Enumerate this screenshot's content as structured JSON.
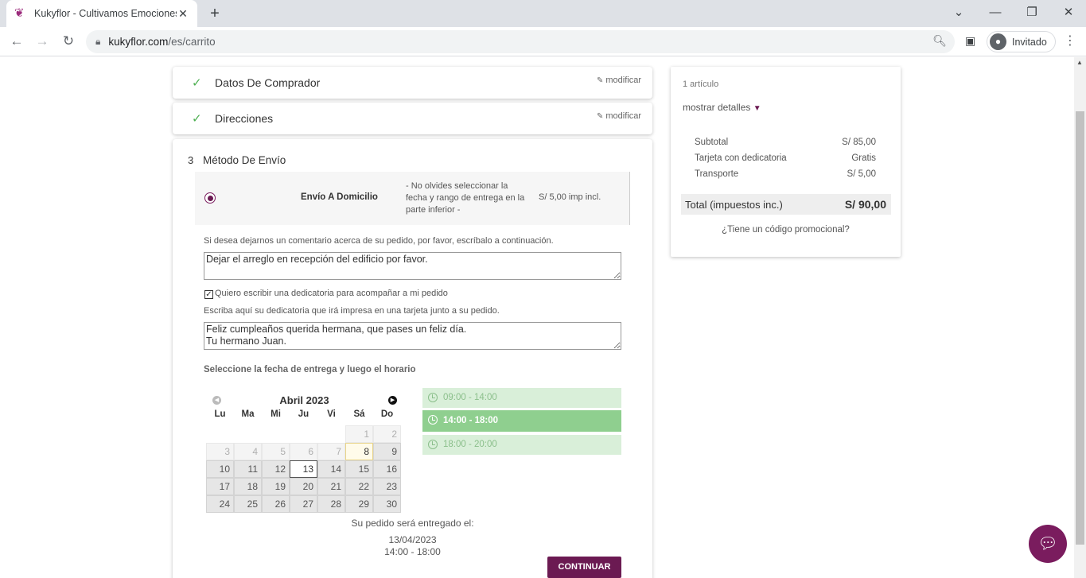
{
  "browser": {
    "tab_title": "Kukyflor - Cultivamos Emociones",
    "url_host": "kukyflor.com",
    "url_path": "/es/carrito",
    "profile_label": "Invitado",
    "new_tab": "+",
    "tab_close": "✕",
    "minimize": "—",
    "chevron": "⌄",
    "restore": "❐",
    "close": "✕",
    "back": "←",
    "forward": "→",
    "reload": "↻"
  },
  "checkout": {
    "step1": {
      "title": "Datos De Comprador",
      "modify": "modificar",
      "check": "✓"
    },
    "step2": {
      "title": "Direcciones",
      "modify": "modificar",
      "check": "✓"
    },
    "step3": {
      "number": "3",
      "title": "Método De Envío",
      "carrier": {
        "name": "Envío A Domicilio",
        "note": "- No olvides seleccionar la fecha y rango de entrega en la parte inferior -",
        "price": "S/ 5,00 imp incl."
      },
      "comment_label": "Si desea dejarnos un comentario acerca de su pedido, por favor, escríbalo a continuación.",
      "comment_value": "Dejar el arreglo en recepción del edificio por favor.",
      "dedication_checkbox_label": "Quiero escribir una dedicatoria para acompañar a mi pedido",
      "dedication_checked": "✓",
      "dedication_label": "Escriba aquí su dedicatoria que irá impresa en una tarjeta junto a su pedido.",
      "dedication_value": "Feliz cumpleaños querida hermana, que pases un feliz día.\nTu hermano Juan.",
      "date_prompt": "Seleccione la fecha de entrega y luego el horario",
      "calendar": {
        "month": "Abril 2023",
        "prev": "◀",
        "next": "▶",
        "weekdays": [
          "Lu",
          "Ma",
          "Mi",
          "Ju",
          "Vi",
          "Sá",
          "Do"
        ],
        "days": [
          {
            "d": "",
            "s": "blank"
          },
          {
            "d": "",
            "s": "blank"
          },
          {
            "d": "",
            "s": "blank"
          },
          {
            "d": "",
            "s": "blank"
          },
          {
            "d": "",
            "s": "blank"
          },
          {
            "d": "1",
            "s": "dis"
          },
          {
            "d": "2",
            "s": "dis"
          },
          {
            "d": "3",
            "s": "dis"
          },
          {
            "d": "4",
            "s": "dis"
          },
          {
            "d": "5",
            "s": "dis"
          },
          {
            "d": "6",
            "s": "dis"
          },
          {
            "d": "7",
            "s": "dis"
          },
          {
            "d": "8",
            "s": "hl"
          },
          {
            "d": "9",
            "s": ""
          },
          {
            "d": "10",
            "s": ""
          },
          {
            "d": "11",
            "s": ""
          },
          {
            "d": "12",
            "s": ""
          },
          {
            "d": "13",
            "s": "sel"
          },
          {
            "d": "14",
            "s": ""
          },
          {
            "d": "15",
            "s": ""
          },
          {
            "d": "16",
            "s": ""
          },
          {
            "d": "17",
            "s": ""
          },
          {
            "d": "18",
            "s": ""
          },
          {
            "d": "19",
            "s": ""
          },
          {
            "d": "20",
            "s": ""
          },
          {
            "d": "21",
            "s": ""
          },
          {
            "d": "22",
            "s": ""
          },
          {
            "d": "23",
            "s": ""
          },
          {
            "d": "24",
            "s": ""
          },
          {
            "d": "25",
            "s": ""
          },
          {
            "d": "26",
            "s": ""
          },
          {
            "d": "27",
            "s": ""
          },
          {
            "d": "28",
            "s": ""
          },
          {
            "d": "29",
            "s": ""
          },
          {
            "d": "30",
            "s": ""
          }
        ]
      },
      "slots": [
        {
          "label": "09:00 - 14:00",
          "active": false
        },
        {
          "label": "14:00 - 18:00",
          "active": true
        },
        {
          "label": "18:00 - 20:00",
          "active": false
        }
      ],
      "delivery_label": "Su pedido será entregado el:",
      "delivery_date": "13/04/2023",
      "delivery_time": "14:00 - 18:00",
      "continue": "CONTINUAR"
    }
  },
  "summary": {
    "items": "1 artículo",
    "details_toggle": "mostrar detalles",
    "rows": [
      {
        "label": "Subtotal",
        "value": "S/ 85,00"
      },
      {
        "label": "Tarjeta con dedicatoria",
        "value": "Gratis"
      },
      {
        "label": "Transporte",
        "value": "S/ 5,00"
      }
    ],
    "total_label": "Total (impuestos inc.)",
    "total_value": "S/ 90,00",
    "promo": "¿Tiene un código promocional?"
  },
  "colors": {
    "brand": "#6b1a52",
    "slot_active": "#8fcf8f",
    "check": "#4caf50"
  }
}
